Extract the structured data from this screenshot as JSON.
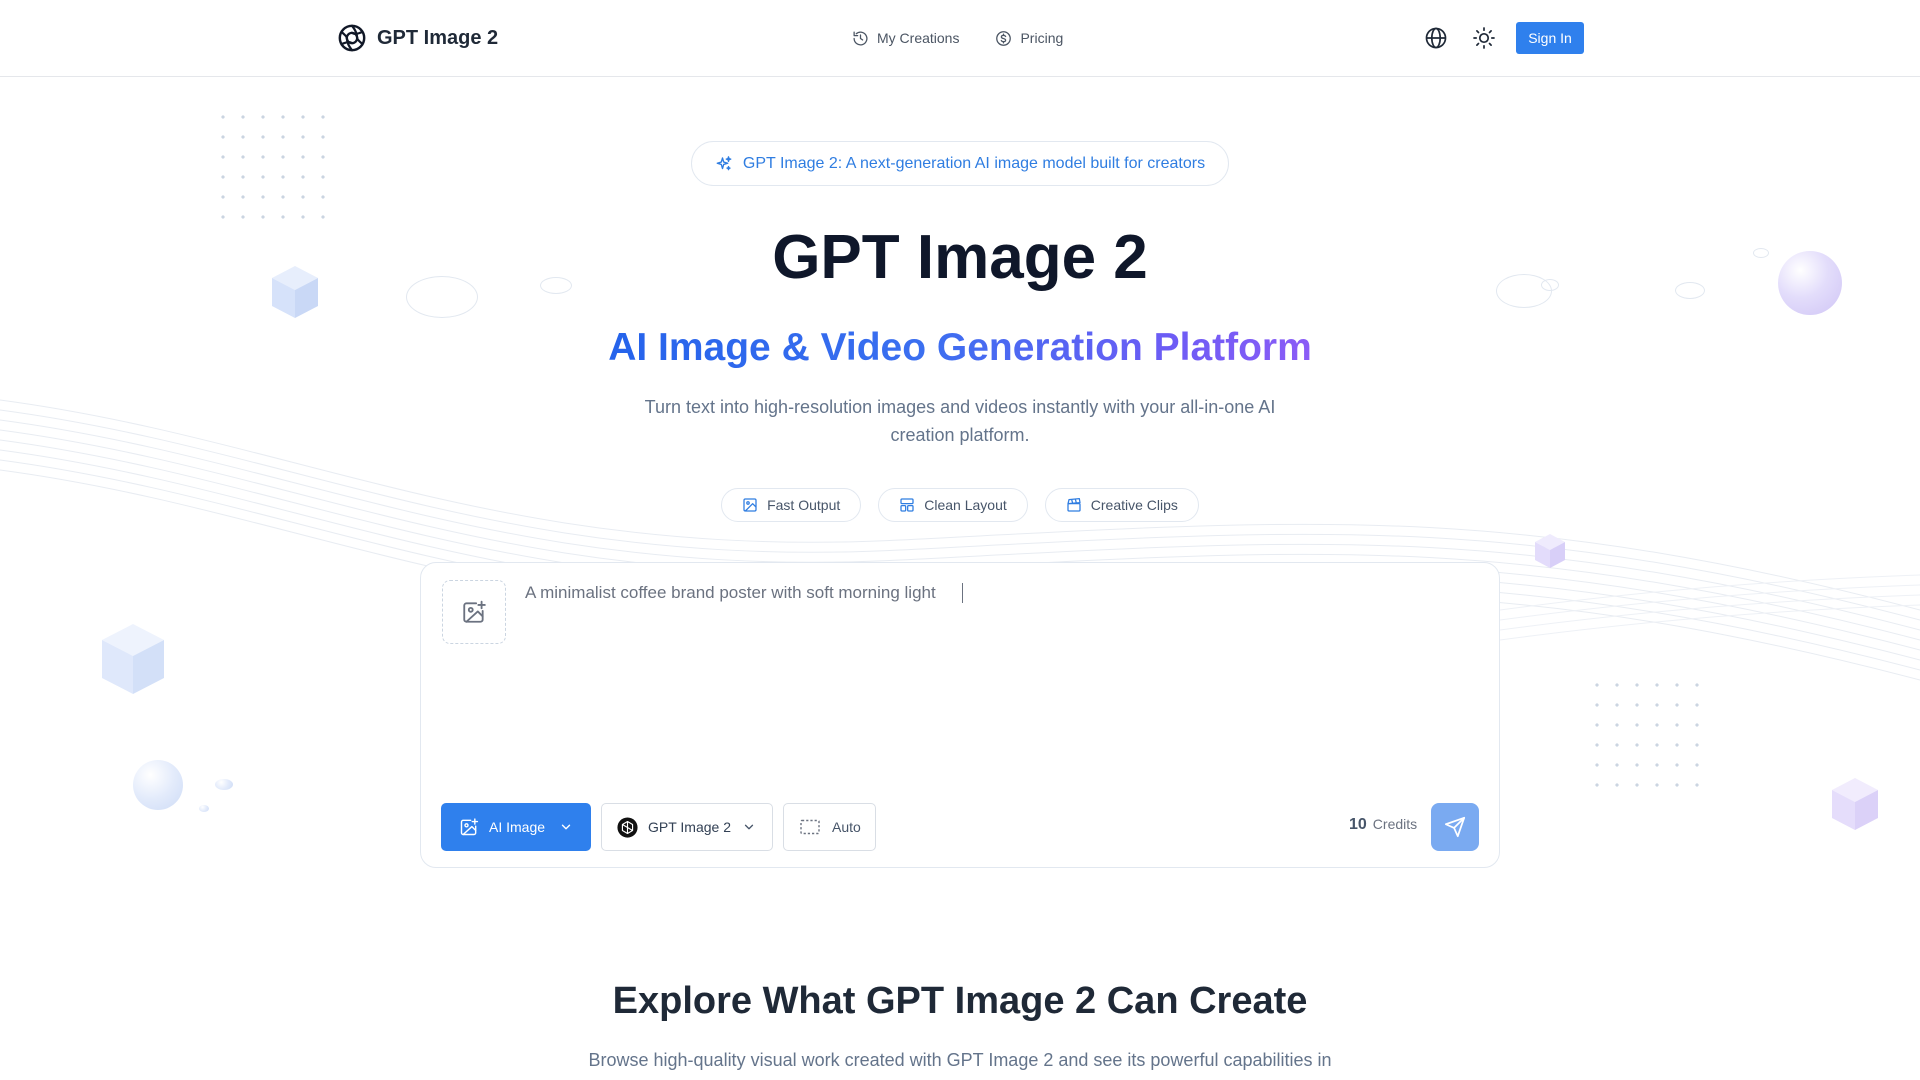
{
  "app": {
    "name": "GPT Image 2"
  },
  "nav": {
    "items": [
      {
        "label": "My Creations",
        "icon": "history-icon"
      },
      {
        "label": "Pricing",
        "icon": "dollar-circle-icon"
      }
    ],
    "language_icon": "globe-icon",
    "theme_icon": "sun-icon",
    "sign_in_label": "Sign In"
  },
  "hero": {
    "badge": "GPT Image 2: A next-generation AI image model built for creators",
    "title": "GPT Image 2",
    "subtitle": "AI Image & Video Generation Platform",
    "description": "Turn text into high-resolution images and videos instantly with your all-in-one AI creation platform.",
    "chips": [
      {
        "label": "Fast Output",
        "icon": "image-icon"
      },
      {
        "label": "Clean Layout",
        "icon": "layout-icon"
      },
      {
        "label": "Creative Clips",
        "icon": "clapperboard-icon"
      }
    ]
  },
  "composer": {
    "prompt_placeholder": "A minimalist coffee brand poster with soft morning light",
    "type_label": "AI Image",
    "model_label": "GPT Image 2",
    "ratio_label": "Auto",
    "credits_value": "10",
    "credits_label": "Credits"
  },
  "explore": {
    "title": "Explore What GPT Image 2 Can Create",
    "description": "Browse high-quality visual work created with GPT Image 2 and see its powerful capabilities in"
  },
  "colors": {
    "primary": "#2f80ed",
    "badge_text": "#2f7de1",
    "gradient_start": "#2563eb",
    "gradient_end": "#8b5cf6",
    "send_button": "#7aaaf1"
  }
}
